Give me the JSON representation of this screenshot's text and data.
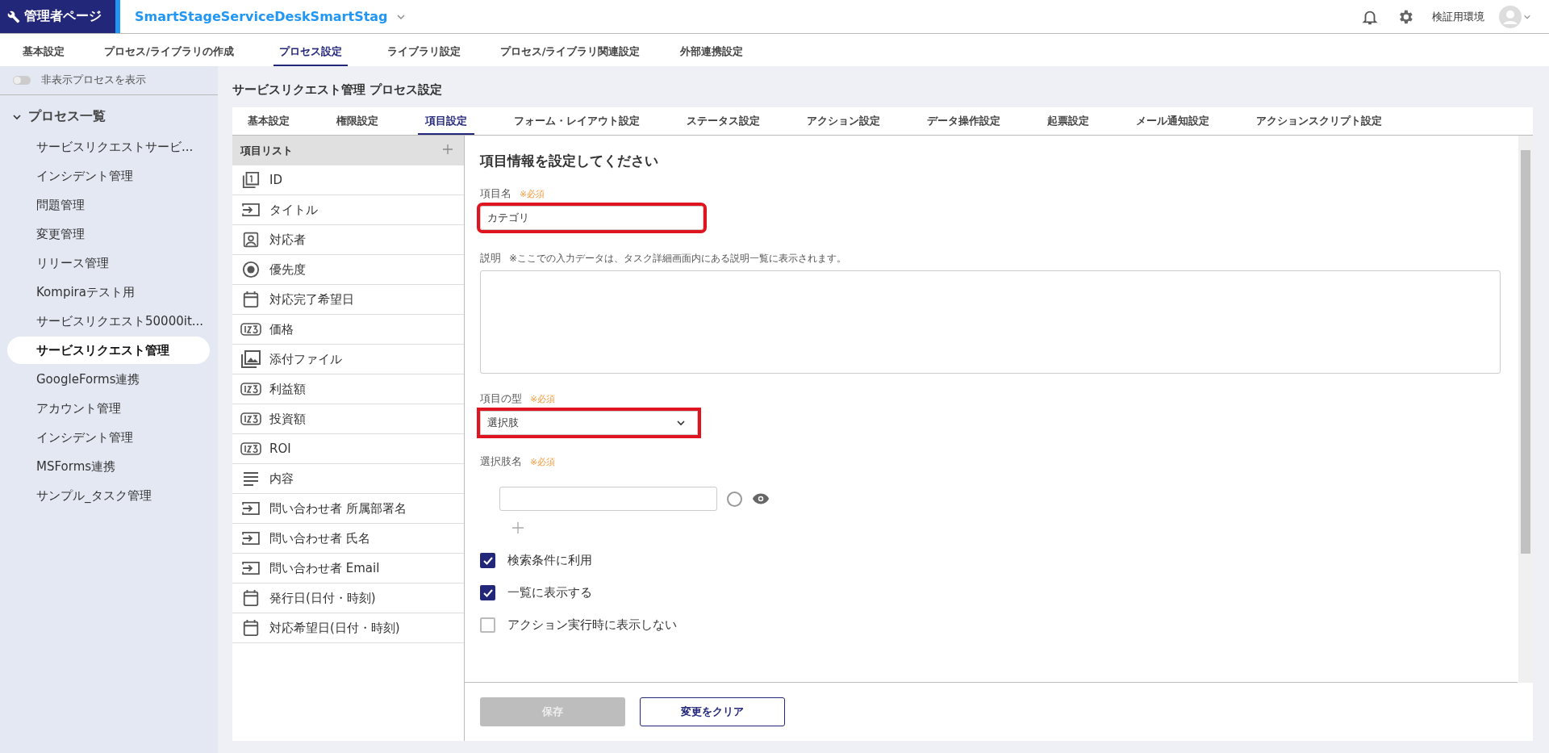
{
  "header": {
    "brand": "管理者ページ",
    "workspace": "SmartStageServiceDeskSmartStag",
    "environment": "検証用環境"
  },
  "nav_tabs": [
    {
      "label": "基本設定",
      "selected": false
    },
    {
      "label": "プロセス/ライブラリの作成",
      "selected": false
    },
    {
      "label": "プロセス設定",
      "selected": true
    },
    {
      "label": "ライブラリ設定",
      "selected": false
    },
    {
      "label": "プロセス/ライブラリ関連設定",
      "selected": false
    },
    {
      "label": "外部連携設定",
      "selected": false
    }
  ],
  "sidebar": {
    "toggle": {
      "label": "非表示プロセスを表示",
      "on": false
    },
    "section": {
      "label": "プロセス一覧",
      "expanded": true
    },
    "items": [
      {
        "label": "サービスリクエストサービ...",
        "selected": false
      },
      {
        "label": "インシデント管理",
        "selected": false
      },
      {
        "label": "問題管理",
        "selected": false
      },
      {
        "label": "変更管理",
        "selected": false
      },
      {
        "label": "リリース管理",
        "selected": false
      },
      {
        "label": "Kompiraテスト用",
        "selected": false
      },
      {
        "label": "サービスリクエスト50000it...",
        "selected": false
      },
      {
        "label": "サービスリクエスト管理",
        "selected": true
      },
      {
        "label": "GoogleForms連携",
        "selected": false
      },
      {
        "label": "アカウント管理",
        "selected": false
      },
      {
        "label": "インシデント管理",
        "selected": false
      },
      {
        "label": "MSForms連携",
        "selected": false
      },
      {
        "label": "サンプル_タスク管理",
        "selected": false
      }
    ]
  },
  "page_title": "サービスリクエスト管理 プロセス設定",
  "tabs": [
    {
      "label": "基本設定",
      "selected": false
    },
    {
      "label": "権限設定",
      "selected": false
    },
    {
      "label": "項目設定",
      "selected": true
    },
    {
      "label": "フォーム・レイアウト設定",
      "selected": false
    },
    {
      "label": "ステータス設定",
      "selected": false
    },
    {
      "label": "アクション設定",
      "selected": false
    },
    {
      "label": "データ操作設定",
      "selected": false
    },
    {
      "label": "起票設定",
      "selected": false
    },
    {
      "label": "メール通知設定",
      "selected": false
    },
    {
      "label": "アクションスクリプト設定",
      "selected": false
    }
  ],
  "item_list": {
    "title": "項目リスト",
    "items": [
      {
        "label": "ID",
        "kind": "id"
      },
      {
        "label": "タイトル",
        "kind": "text"
      },
      {
        "label": "対応者",
        "kind": "user"
      },
      {
        "label": "優先度",
        "kind": "radio"
      },
      {
        "label": "対応完了希望日",
        "kind": "date"
      },
      {
        "label": "価格",
        "kind": "number"
      },
      {
        "label": "添付ファイル",
        "kind": "file"
      },
      {
        "label": "利益額",
        "kind": "number"
      },
      {
        "label": "投資額",
        "kind": "number"
      },
      {
        "label": "ROI",
        "kind": "number"
      },
      {
        "label": "内容",
        "kind": "textarea"
      },
      {
        "label": "問い合わせ者 所属部署名",
        "kind": "text"
      },
      {
        "label": "問い合わせ者 氏名",
        "kind": "text"
      },
      {
        "label": "問い合わせ者 Email",
        "kind": "text"
      },
      {
        "label": "発行日(日付・時刻)",
        "kind": "date"
      },
      {
        "label": "対応希望日(日付・時刻)",
        "kind": "date"
      }
    ]
  },
  "form": {
    "heading": "項目情報を設定してください",
    "name_field": {
      "label": "項目名",
      "required": "※必須",
      "value": "カテゴリ",
      "highlighted": true
    },
    "description_field": {
      "label": "説明",
      "note": "※ここでの入力データは、タスク詳細画面内にある説明一覧に表示されます。"
    },
    "type_field": {
      "label": "項目の型",
      "required": "※必須",
      "value": "選択肢",
      "highlighted": true
    },
    "options": {
      "label": "選択肢名",
      "required": "※必須"
    },
    "checkboxes": [
      {
        "label": "検索条件に利用",
        "checked": true
      },
      {
        "label": "一覧に表示する",
        "checked": true
      },
      {
        "label": "アクション実行時に表示しない",
        "checked": false
      }
    ],
    "buttons": {
      "save": {
        "label": "保存",
        "disabled": true
      },
      "clear": {
        "label": "変更をクリア"
      }
    }
  }
}
